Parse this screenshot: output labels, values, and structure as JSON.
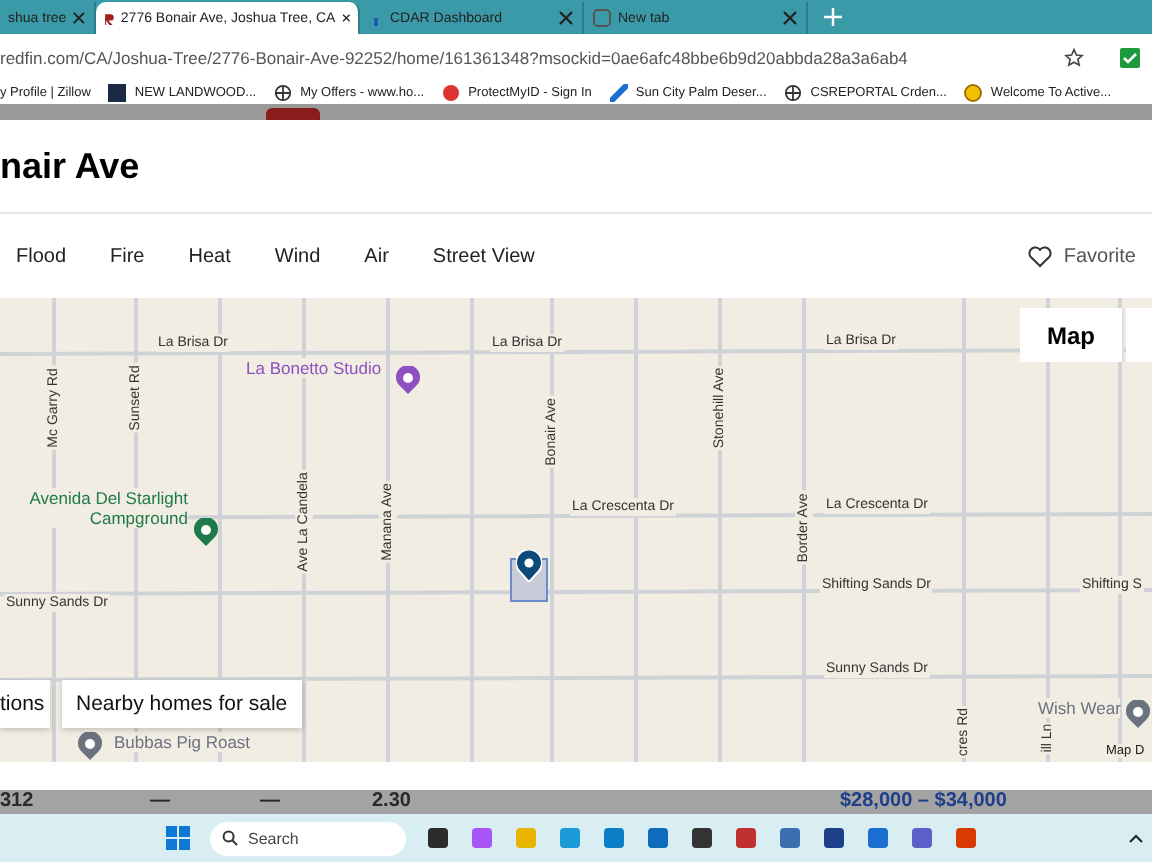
{
  "browser": {
    "tabs": [
      {
        "title": "shua tree",
        "selected": false
      },
      {
        "title": "2776 Bonair Ave, Joshua Tree, CA",
        "selected": true
      },
      {
        "title": "CDAR Dashboard",
        "selected": false
      },
      {
        "title": "New tab",
        "selected": false
      }
    ],
    "address": "redfin.com/CA/Joshua-Tree/2776-Bonair-Ave-92252/home/161361348?msockid=0ae6afc48bbe6b9d20abbda28a3a6ab4",
    "bookmarks": [
      "y Profile | Zillow",
      "NEW LANDWOOD...",
      "My Offers - www.ho...",
      "ProtectMyID - Sign In",
      "Sun City Palm Deser...",
      "CSREPORTAL Crden...",
      "Welcome To Active..."
    ]
  },
  "page": {
    "title": "nair Ave",
    "nav": [
      "Flood",
      "Fire",
      "Heat",
      "Wind",
      "Air",
      "Street View"
    ],
    "favorite": "Favorite"
  },
  "map": {
    "mode_button": "Map",
    "streets": [
      "La Brisa Dr",
      "La Brisa Dr",
      "La Brisa Dr",
      "Mc Garry Rd",
      "Sunset Rd",
      "Ave La Candela",
      "Manana Ave",
      "Bonair Ave",
      "Stonehill Ave",
      "Border Ave",
      "La Crescenta Dr",
      "La Crescenta Dr",
      "Sunny Sands Dr",
      "Shifting Sands Dr",
      "Shifting S",
      "Sunny Sands Dr",
      "cres Rd",
      "ill Ln"
    ],
    "places": [
      {
        "name": "La Bonetto Studio",
        "color": "#8e4fc0"
      },
      {
        "name": "Avenida Del Starlight Campground",
        "color": "#1e7a4a"
      },
      {
        "name": "Bubbas Pig Roast",
        "color": "#6b7280"
      },
      {
        "name": "Wish Wear",
        "color": "#6b7280"
      }
    ],
    "buttons": [
      "tions",
      "Nearby homes for sale"
    ],
    "attribution": "Map D"
  },
  "stats_strip": [
    "312",
    "—",
    "—",
    "2.30",
    "$28,000 – $34,000"
  ],
  "taskbar": {
    "search_placeholder": "Search"
  }
}
